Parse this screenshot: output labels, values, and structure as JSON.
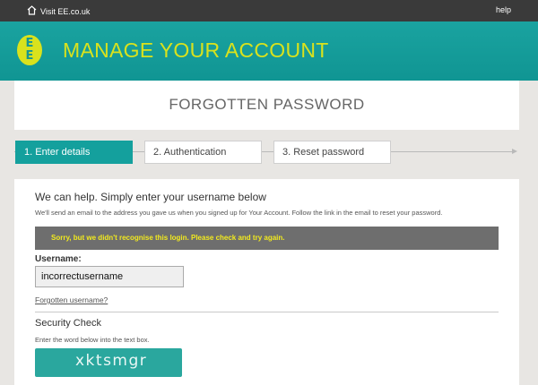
{
  "topbar": {
    "visit_label": "Visit EE.co.uk",
    "help_label": "help"
  },
  "header": {
    "logo_top": "E",
    "logo_bottom": "E",
    "title": "MANAGE YOUR ACCOUNT"
  },
  "page": {
    "title": "FORGOTTEN PASSWORD"
  },
  "steps": [
    {
      "label": "1. Enter details",
      "active": true
    },
    {
      "label": "2. Authentication",
      "active": false
    },
    {
      "label": "3. Reset password",
      "active": false
    }
  ],
  "form": {
    "heading": "We can help. Simply enter your username below",
    "subtext": "We'll send an email to the address you gave us when you signed up for Your Account. Follow the link in the email to reset your password.",
    "error": "Sorry, but we didn't recognise this login. Please check and try again.",
    "username_label": "Username:",
    "username_value": "incorrectusername",
    "forgot_link": "Forgotten username?",
    "security_title": "Security Check",
    "security_sub": "Enter the word below into the text box.",
    "captcha_text": "xktsmgr"
  },
  "colors": {
    "header_bg": "#14a09d",
    "accent_yellow": "#d9e21d",
    "error_bg": "#6e6e6e",
    "error_text": "#f2ea1e"
  },
  "icons": {
    "visit": "home-icon"
  }
}
